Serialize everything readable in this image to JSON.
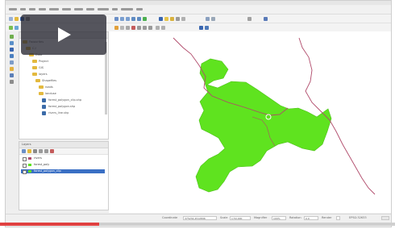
{
  "app": {
    "title": "QGIS"
  },
  "menu": {
    "items": [
      "Project",
      "Edit",
      "View",
      "Layer",
      "Settings",
      "Plugins",
      "Vector",
      "Raster",
      "Database",
      "Web",
      "Processing",
      "Help"
    ]
  },
  "browser": {
    "items": [
      {
        "label": "Favourites",
        "kind": "folder"
      },
      {
        "label": "C:/",
        "kind": "folder"
      },
      {
        "label": "Data",
        "kind": "folder"
      },
      {
        "label": "Project",
        "kind": "folder"
      },
      {
        "label": "GIS",
        "kind": "folder"
      },
      {
        "label": "layers",
        "kind": "folder"
      },
      {
        "label": "Shapefiles",
        "kind": "folder"
      },
      {
        "label": "roads",
        "kind": "folder"
      },
      {
        "label": "landuse",
        "kind": "folder"
      },
      {
        "label": "forest_polygon_clip.shp",
        "kind": "file"
      },
      {
        "label": "forest_polygon.shp",
        "kind": "file"
      },
      {
        "label": "rivers_line.shp",
        "kind": "file"
      }
    ]
  },
  "layers_panel": {
    "title": "Layers",
    "items": [
      {
        "label": "rivers",
        "selected": false
      },
      {
        "label": "forest_poly",
        "selected": false
      },
      {
        "label": "forest_polygon_clip",
        "selected": true
      }
    ]
  },
  "status": {
    "coordinate_label": "Coordinate",
    "coordinate_value": "375234,4512896",
    "scale_label": "Scale",
    "scale_value": "1:50,000",
    "magnifier_label": "Magnifier",
    "magnifier_value": "100%",
    "rotation_label": "Rotation",
    "rotation_value": "0.0",
    "render_label": "Render",
    "crs_label": "EPSG:32633"
  },
  "video": {
    "progress": 0.25,
    "overlay_color": "#28282f",
    "progress_color": "#e04040"
  },
  "map": {
    "polygon_color": "#5fe31f",
    "line_color": "#b04a6a",
    "icons": [
      "zoom-in-icon",
      "zoom-out-icon",
      "pan-icon",
      "identify-icon",
      "select-icon",
      "measure-icon",
      "add-layer-icon",
      "save-icon"
    ]
  }
}
